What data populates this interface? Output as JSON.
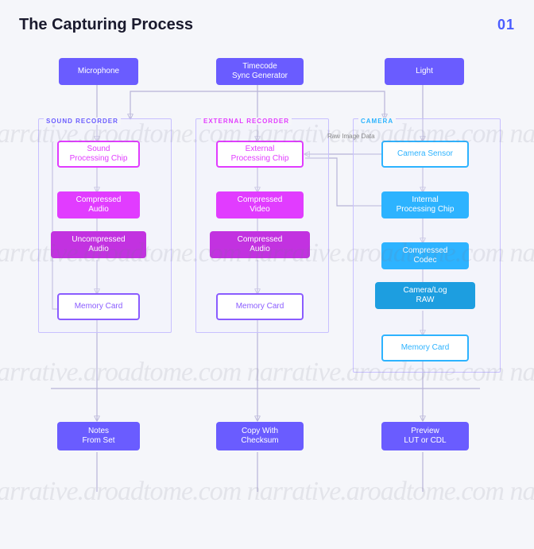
{
  "header": {
    "title": "The Capturing Process",
    "page_number": "01"
  },
  "top_inputs": {
    "microphone": "Microphone",
    "timecode": "Timecode\nSync Generator",
    "light": "Light"
  },
  "groups": {
    "sound": {
      "label": "SOUND RECORDER"
    },
    "external": {
      "label": "EXTERNAL RECORDER"
    },
    "camera": {
      "label": "CAMERA"
    }
  },
  "annotations": {
    "raw_image": "Raw Image Data"
  },
  "sound": {
    "proc": "Sound\nProcessing Chip",
    "compressed": "Compressed\nAudio",
    "uncompressed": "Uncompressed\nAudio",
    "memory": "Memory Card"
  },
  "external": {
    "proc": "External\nProcessing Chip",
    "compressed_video": "Compressed\nVideo",
    "compressed_audio": "Compressed\nAudio",
    "memory": "Memory Card"
  },
  "camera": {
    "sensor": "Camera Sensor",
    "proc": "Internal\nProcessing Chip",
    "codec": "Compressed\nCodec",
    "raw": "Camera/Log\nRAW",
    "memory": "Memory Card"
  },
  "outputs": {
    "notes": "Notes\nFrom Set",
    "copy": "Copy With\nChecksum",
    "preview": "Preview\nLUT or CDL"
  },
  "watermark": "narrative.aroadtome.com narrative.aroadtome.com narrative"
}
